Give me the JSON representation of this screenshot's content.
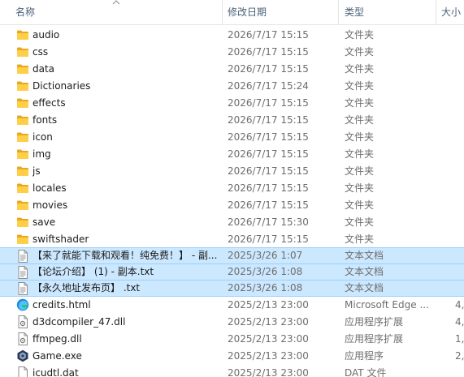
{
  "header": {
    "name_label": "名称",
    "date_label": "修改日期",
    "type_label": "类型",
    "size_label": "大小"
  },
  "files": [
    {
      "name": "audio",
      "date": "2026/7/17 15:15",
      "type": "文件夹",
      "size": "",
      "icon": "folder-icon",
      "selected": false
    },
    {
      "name": "css",
      "date": "2026/7/17 15:15",
      "type": "文件夹",
      "size": "",
      "icon": "folder-icon",
      "selected": false
    },
    {
      "name": "data",
      "date": "2026/7/17 15:15",
      "type": "文件夹",
      "size": "",
      "icon": "folder-icon",
      "selected": false
    },
    {
      "name": "Dictionaries",
      "date": "2026/7/17 15:24",
      "type": "文件夹",
      "size": "",
      "icon": "folder-icon",
      "selected": false
    },
    {
      "name": "effects",
      "date": "2026/7/17 15:15",
      "type": "文件夹",
      "size": "",
      "icon": "folder-icon",
      "selected": false
    },
    {
      "name": "fonts",
      "date": "2026/7/17 15:15",
      "type": "文件夹",
      "size": "",
      "icon": "folder-icon",
      "selected": false
    },
    {
      "name": "icon",
      "date": "2026/7/17 15:15",
      "type": "文件夹",
      "size": "",
      "icon": "folder-icon",
      "selected": false
    },
    {
      "name": "img",
      "date": "2026/7/17 15:15",
      "type": "文件夹",
      "size": "",
      "icon": "folder-icon",
      "selected": false
    },
    {
      "name": "js",
      "date": "2026/7/17 15:15",
      "type": "文件夹",
      "size": "",
      "icon": "folder-icon",
      "selected": false
    },
    {
      "name": "locales",
      "date": "2026/7/17 15:15",
      "type": "文件夹",
      "size": "",
      "icon": "folder-icon",
      "selected": false
    },
    {
      "name": "movies",
      "date": "2026/7/17 15:15",
      "type": "文件夹",
      "size": "",
      "icon": "folder-icon",
      "selected": false
    },
    {
      "name": "save",
      "date": "2026/7/17 15:30",
      "type": "文件夹",
      "size": "",
      "icon": "folder-icon",
      "selected": false
    },
    {
      "name": "swiftshader",
      "date": "2026/7/17 15:15",
      "type": "文件夹",
      "size": "",
      "icon": "folder-icon",
      "selected": false
    },
    {
      "name": "【来了就能下载和观看！纯免费！】 - 副...",
      "date": "2025/3/26 1:07",
      "type": "文本文档",
      "size": "",
      "icon": "text-file-icon",
      "selected": true
    },
    {
      "name": "【论坛介绍】 (1) - 副本.txt",
      "date": "2025/3/26 1:08",
      "type": "文本文档",
      "size": "",
      "icon": "text-file-icon",
      "selected": true
    },
    {
      "name": "【永久地址发布页】 .txt",
      "date": "2025/3/26 1:08",
      "type": "文本文档",
      "size": "",
      "icon": "text-file-icon",
      "selected": true
    },
    {
      "name": "credits.html",
      "date": "2025/2/13 23:00",
      "type": "Microsoft Edge ...",
      "size": "4,",
      "icon": "edge-icon",
      "selected": false
    },
    {
      "name": "d3dcompiler_47.dll",
      "date": "2025/2/13 23:00",
      "type": "应用程序扩展",
      "size": "4,",
      "icon": "dll-file-icon",
      "selected": false
    },
    {
      "name": "ffmpeg.dll",
      "date": "2025/2/13 23:00",
      "type": "应用程序扩展",
      "size": "1,",
      "icon": "dll-file-icon",
      "selected": false
    },
    {
      "name": "Game.exe",
      "date": "2025/2/13 23:00",
      "type": "应用程序",
      "size": "2,",
      "icon": "game-exe-icon",
      "selected": false
    },
    {
      "name": "icudtl.dat",
      "date": "2025/2/13 23:00",
      "type": "DAT 文件",
      "size": "",
      "icon": "dat-file-icon",
      "selected": false
    }
  ]
}
